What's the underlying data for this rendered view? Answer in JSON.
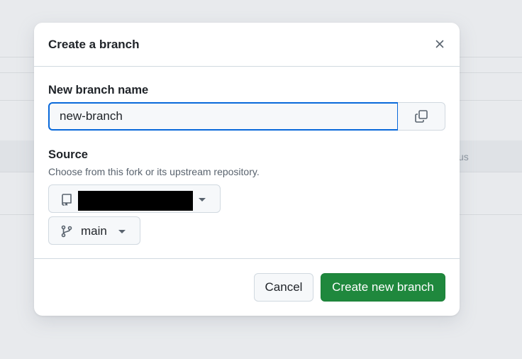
{
  "background": {
    "partial_text": "us"
  },
  "dialog": {
    "title": "Create a branch",
    "close_icon": "close-icon"
  },
  "branch_name": {
    "label": "New branch name",
    "value": "new-branch",
    "copy_icon": "copy-icon"
  },
  "source": {
    "label": "Source",
    "hint": "Choose from this fork or its upstream repository.",
    "repo_icon": "repo-icon",
    "repo_name_redacted": true,
    "branch_icon": "git-branch-icon",
    "branch": "main"
  },
  "actions": {
    "cancel_label": "Cancel",
    "create_label": "Create new branch"
  },
  "colors": {
    "primary_green": "#1f883d",
    "focus_blue": "#0969da",
    "border": "#d1d9e0",
    "overlay_bg": "#e8eaed"
  }
}
